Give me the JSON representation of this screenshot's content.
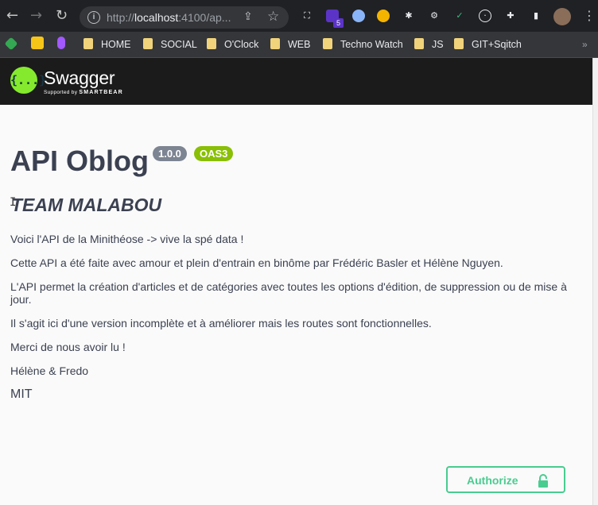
{
  "browser": {
    "url_scheme": "http://",
    "url_host": "localhost",
    "url_rest": ":4100/ap...",
    "extension_badge": "5",
    "bookmarks": [
      "HOME",
      "SOCIAL",
      "O'Clock",
      "WEB",
      "Techno Watch",
      "JS",
      "GIT+Sqitch"
    ],
    "bookmarks_overflow": "»"
  },
  "swagger": {
    "logo_glyph": "{...}",
    "logo_text": "Swagger",
    "logo_sub_prefix": "Supported by",
    "logo_sub_brand": "SMARTBEAR"
  },
  "info": {
    "title": "API Oblog",
    "version": "1.0.0",
    "oas": "OAS3",
    "team": "TEAM MALABOU",
    "paragraphs": [
      "Voici l'API de la Minithéose -> vive la spé data !",
      "Cette API a été faite avec amour et plein d'entrain en binôme par Frédéric Basler et Hélène Nguyen.",
      "L'API permet la création d'articles et de catégories avec toutes les options d'édition, de suppression ou de mise à jour.",
      "Il s'agit ici d'une version incomplète et à améliorer mais les routes sont fonctionnelles.",
      "Merci de nous avoir lu !",
      "Hélène & Fredo"
    ],
    "license": "MIT"
  },
  "authorize": {
    "label": "Authorize"
  },
  "colors": {
    "accent": "#49cc90",
    "logo": "#85ea2d",
    "version_pill": "#7d8492",
    "oas_pill": "#89bf04",
    "text": "#3b4151"
  }
}
